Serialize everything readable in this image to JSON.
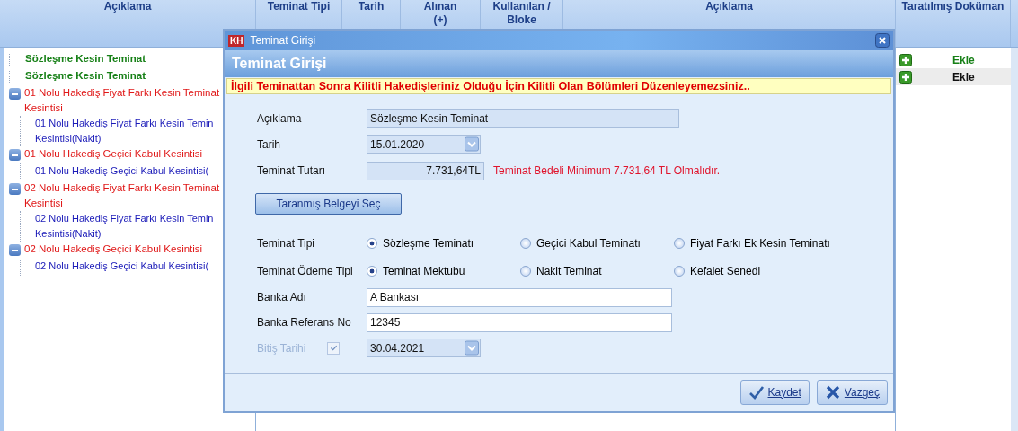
{
  "grid": {
    "columns": [
      "Açıklama",
      "Teminat Tipi",
      "Tarih",
      "Alınan\n(+)",
      "Kullanılan /\nBloke",
      "Açıklama",
      "Taratılmış Doküman"
    ],
    "tree": [
      {
        "label": "Sözleşme Kesin Teminat",
        "kind": "guarantee"
      },
      {
        "label": "Sözleşme Kesin Teminat",
        "kind": "guarantee"
      },
      {
        "label": "01 Nolu Hakediş Fiyat Farkı Kesin Teminat Kesintisi",
        "kind": "deduction",
        "expanded": true,
        "children": [
          {
            "label": "01 Nolu Hakediş Fiyat Farkı Kesin Temin Kesintisi(Nakit)",
            "kind": "sub"
          }
        ]
      },
      {
        "label": "01 Nolu Hakediş Geçici Kabul Kesintisi",
        "kind": "deduction",
        "expanded": true,
        "children": [
          {
            "label": "01 Nolu Hakediş Geçici Kabul Kesintisi(",
            "kind": "sub"
          }
        ]
      },
      {
        "label": "02 Nolu Hakediş Fiyat Farkı Kesin Teminat Kesintisi",
        "kind": "deduction",
        "expanded": true,
        "children": [
          {
            "label": "02 Nolu Hakediş Fiyat Farkı Kesin Temin Kesintisi(Nakit)",
            "kind": "sub"
          }
        ]
      },
      {
        "label": "02 Nolu Hakediş Geçici Kabul Kesintisi",
        "kind": "deduction",
        "expanded": true,
        "children": [
          {
            "label": "02 Nolu Hakediş Geçici Kabul Kesintisi(",
            "kind": "sub"
          }
        ]
      }
    ],
    "documents": [
      {
        "label": "Ekle",
        "selected": false
      },
      {
        "label": "Ekle",
        "selected": true
      }
    ]
  },
  "dialog": {
    "logo": "KH",
    "title": "Teminat Girişi",
    "heading": "Teminat Girişi",
    "warning": "İlgili Teminattan Sonra Kilitli Hakedişleriniz Olduğu İçin Kilitli Olan Bölümleri Düzenleyemezsiniz..",
    "fields": [
      {
        "kind": "readonly",
        "label": "Açıklama",
        "value": "Sözleşme Kesin Teminat"
      },
      {
        "kind": "date",
        "label": "Tarih",
        "value": "15.01.2020"
      },
      {
        "kind": "amount",
        "label": "Teminat Tutarı",
        "value": "7.731,64TL",
        "note": "Teminat Bedeli Minimum 7.731,64 TL Olmalıdır."
      },
      {
        "kind": "button",
        "label": "Taranmış Belgeyi Seç"
      },
      {
        "kind": "radio",
        "label": "Teminat Tipi",
        "options": [
          {
            "label": "Sözleşme Teminatı",
            "selected": true
          },
          {
            "label": "Geçici Kabul Teminatı",
            "selected": false
          },
          {
            "label": "Fiyat Farkı Ek Kesin Teminatı",
            "selected": false
          }
        ]
      },
      {
        "kind": "radio",
        "label": "Teminat Ödeme Tipi",
        "options": [
          {
            "label": "Teminat Mektubu",
            "selected": true
          },
          {
            "label": "Nakit Teminat",
            "selected": false
          },
          {
            "label": "Kefalet Senedi",
            "selected": false
          }
        ]
      },
      {
        "kind": "text",
        "label": "Banka Adı",
        "value": "A Bankası"
      },
      {
        "kind": "text",
        "label": "Banka Referans No",
        "value": "12345"
      },
      {
        "kind": "optional_date",
        "label": "Bitiş Tarihi",
        "checked": true,
        "disabled": true,
        "value": "30.04.2021"
      }
    ],
    "buttons": [
      {
        "kind": "save",
        "label": "Kaydet"
      },
      {
        "kind": "cancel",
        "label": "Vazgeç"
      }
    ]
  }
}
